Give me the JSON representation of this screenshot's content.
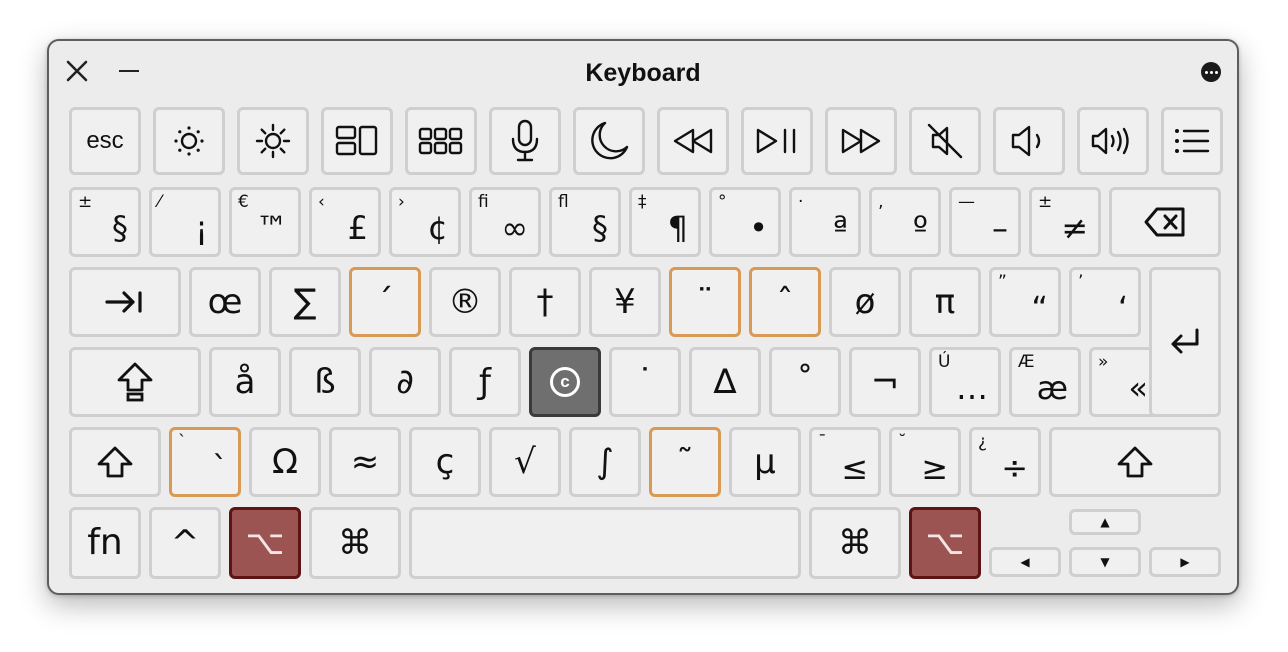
{
  "window": {
    "title": "Keyboard"
  },
  "rows": {
    "function": [
      {
        "main": "esc"
      },
      {
        "icon": "brightness-down-icon"
      },
      {
        "icon": "brightness-up-icon"
      },
      {
        "icon": "mission-control-icon"
      },
      {
        "icon": "launchpad-icon"
      },
      {
        "icon": "microphone-icon"
      },
      {
        "icon": "do-not-disturb-moon-icon"
      },
      {
        "icon": "rewind-icon"
      },
      {
        "icon": "play-pause-icon"
      },
      {
        "icon": "fast-forward-icon"
      },
      {
        "icon": "mute-icon"
      },
      {
        "icon": "volume-down-icon"
      },
      {
        "icon": "volume-up-icon"
      },
      {
        "icon": "list-icon"
      }
    ],
    "number": [
      {
        "alt": "±",
        "main": "§"
      },
      {
        "alt": "⁄",
        "main": "¡"
      },
      {
        "alt": "€",
        "main": "™"
      },
      {
        "alt": "‹",
        "main": "£"
      },
      {
        "alt": "›",
        "main": "¢"
      },
      {
        "alt": "ﬁ",
        "main": "∞"
      },
      {
        "alt": "ﬂ",
        "main": "§"
      },
      {
        "alt": "‡",
        "main": "¶"
      },
      {
        "alt": "°",
        "main": "•"
      },
      {
        "alt": "·",
        "main": "ª"
      },
      {
        "alt": "‚",
        "main": "º"
      },
      {
        "alt": "—",
        "main": "–"
      },
      {
        "alt": "±",
        "main": "≠"
      },
      {
        "icon": "delete-icon"
      }
    ],
    "top": [
      {
        "icon": "tab-icon"
      },
      {
        "main": "œ"
      },
      {
        "main": "∑"
      },
      {
        "main": "´",
        "dead": true
      },
      {
        "main": "®"
      },
      {
        "main": "†"
      },
      {
        "main": "¥"
      },
      {
        "main": "¨",
        "dead": true
      },
      {
        "main": "ˆ",
        "dead": true
      },
      {
        "main": "ø"
      },
      {
        "main": "π"
      },
      {
        "alt": "”",
        "main": "“"
      },
      {
        "alt": "’",
        "main": "‘"
      }
    ],
    "home": [
      {
        "icon": "caps-lock-icon"
      },
      {
        "main": "å"
      },
      {
        "main": "ß"
      },
      {
        "main": "∂"
      },
      {
        "main": "ƒ"
      },
      {
        "main": "©",
        "selected": true
      },
      {
        "main": "˙"
      },
      {
        "main": "∆"
      },
      {
        "main": "˚"
      },
      {
        "main": "¬"
      },
      {
        "alt": "Ú",
        "main": "…"
      },
      {
        "alt": "Æ",
        "main": "æ"
      },
      {
        "alt": "»",
        "main": "«"
      }
    ],
    "bottom": [
      {
        "icon": "shift-icon"
      },
      {
        "alt": "`",
        "main": "`",
        "dead": true
      },
      {
        "main": "Ω"
      },
      {
        "main": "≈"
      },
      {
        "main": "ç"
      },
      {
        "main": "√"
      },
      {
        "main": "∫"
      },
      {
        "main": "˜",
        "dead": true
      },
      {
        "main": "µ"
      },
      {
        "alt": "¯",
        "main": "≤"
      },
      {
        "alt": "˘",
        "main": "≥"
      },
      {
        "alt": "¿",
        "main": "÷"
      },
      {
        "icon": "shift-icon"
      }
    ],
    "modifier": [
      {
        "main": "fn"
      },
      {
        "main": "^"
      },
      {
        "main": "⌥",
        "pressed": true
      },
      {
        "main": "⌘"
      },
      {
        "main": ""
      },
      {
        "main": "⌘"
      },
      {
        "main": "⌥",
        "pressed": true
      }
    ],
    "arrows": {
      "up": "▲",
      "left": "◀",
      "down": "▼",
      "right": "▶"
    }
  },
  "return_key": {
    "icon": "return-icon"
  },
  "colors": {
    "window_bg": "#ececec",
    "key_bg": "#f0f0f0",
    "key_border": "#cfcfcf",
    "dead_key_border": "#d89a55",
    "pressed_key_bg": "#9c5452",
    "selected_key_bg": "#6f6f6f"
  }
}
